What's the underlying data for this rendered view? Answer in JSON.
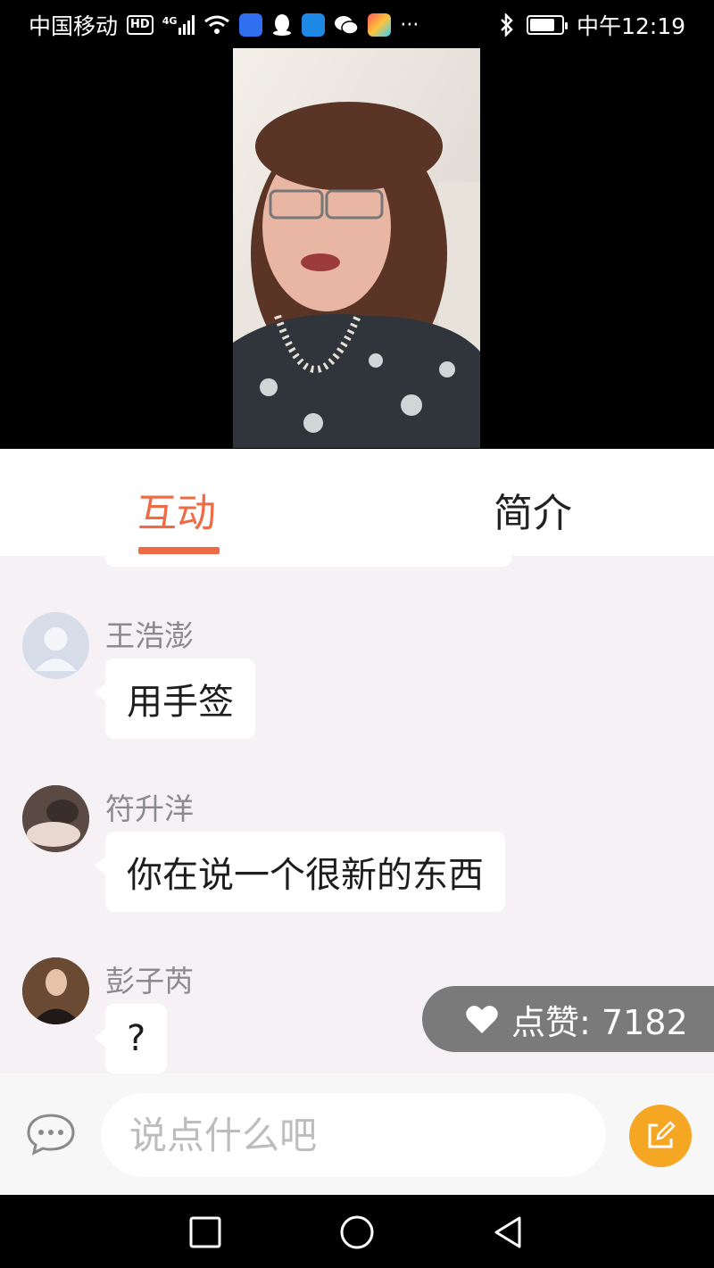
{
  "status_bar": {
    "carrier": "中国移动",
    "hd_badge": "HD",
    "network": "4G",
    "time": "中午12:19"
  },
  "tabs": [
    {
      "label": "互动",
      "active": true
    },
    {
      "label": "简介",
      "active": false
    }
  ],
  "messages": [
    {
      "user": "王浩澎",
      "text": "用手签",
      "avatar": "default-avatar-icon"
    },
    {
      "user": "符升洋",
      "text": "你在说一个很新的东西",
      "avatar": "user-photo"
    },
    {
      "user": "彭子芮",
      "text": "?",
      "avatar": "user-photo"
    }
  ],
  "likes": {
    "label": "点赞",
    "separator": ":",
    "count": "7182"
  },
  "input": {
    "placeholder": "说点什么吧"
  },
  "colors": {
    "accent": "#ef6b46",
    "edit_button": "#f5a623",
    "chat_bg": "#f5f1f5"
  }
}
